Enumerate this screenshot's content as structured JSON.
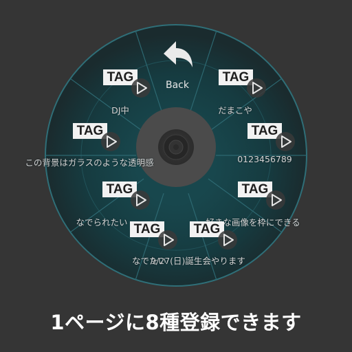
{
  "wheel": {
    "back_label": "Back",
    "back_icon": "curved-back-arrow-icon",
    "center_icon": "camera-lens-icon",
    "colors": {
      "ring_outer": "#1b3034",
      "ring_inner": "#173f45",
      "ring_edge": "#2f6f78",
      "divider": "#2d6871",
      "hub": "#4b4b4b",
      "badge_bg": "#f2f2f2",
      "badge_text": "#1e1e1e"
    },
    "items": [
      {
        "badge": "TAG",
        "label": "だまこや",
        "icon": "play-icon"
      },
      {
        "badge": "TAG",
        "label": "0123456789",
        "icon": "play-icon"
      },
      {
        "badge": "TAG",
        "label": "好きな画像を枠にできる",
        "icon": "play-icon"
      },
      {
        "badge": "TAG",
        "label": "9/27(日)誕生会やります",
        "icon": "play-icon"
      },
      {
        "badge": "TAG",
        "label": "なでたい",
        "icon": "play-icon"
      },
      {
        "badge": "TAG",
        "label": "なでられたい",
        "icon": "play-icon"
      },
      {
        "badge": "TAG",
        "label": "この背景はガラスのような透明感",
        "icon": "play-icon"
      },
      {
        "badge": "TAG",
        "label": "DJ中",
        "icon": "play-icon"
      }
    ]
  },
  "caption": "1ページに8種登録できます",
  "page_background": "#353535"
}
